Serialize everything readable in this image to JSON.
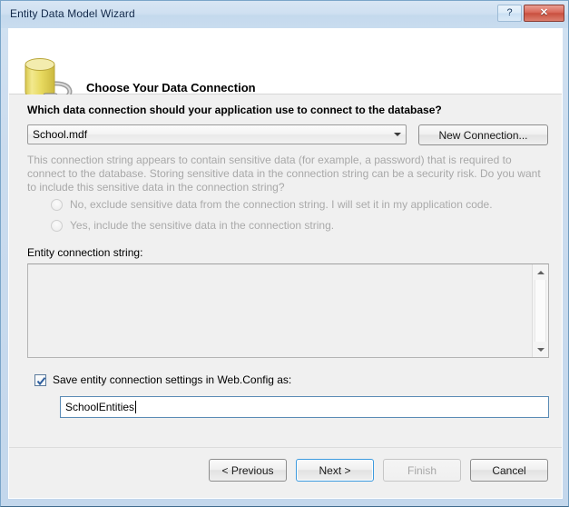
{
  "window": {
    "title": "Entity Data Model Wizard",
    "help_button": "?",
    "close_button": "✕"
  },
  "header": {
    "title": "Choose Your Data Connection",
    "icon": "database-plug-icon"
  },
  "main": {
    "question": "Which data connection should your application use to connect to the database?",
    "connection_combo": {
      "value": "School.mdf",
      "arrow_icon": "chevron-down-icon"
    },
    "new_connection_button": "New Connection...",
    "sensitive_warning": "This connection string appears to contain sensitive data (for example, a password) that is required to connect to the database. Storing sensitive data in the connection string can be a security risk. Do you want to include this sensitive data in the connection string?",
    "radios": [
      {
        "label": "No, exclude sensitive data from the connection string. I will set it in my application code.",
        "checked": false,
        "disabled": true
      },
      {
        "label": "Yes, include the sensitive data in the connection string.",
        "checked": false,
        "disabled": true
      }
    ],
    "entity_connection_string_label": "Entity connection string:",
    "entity_connection_string_value": "",
    "save_checkbox": {
      "label": "Save entity connection settings in Web.Config as:",
      "checked": true
    },
    "config_name_input": {
      "value": "SchoolEntities"
    }
  },
  "footer": {
    "buttons": [
      {
        "label": "< Previous",
        "state": "enabled"
      },
      {
        "label": "Next >",
        "state": "default"
      },
      {
        "label": "Finish",
        "state": "disabled"
      },
      {
        "label": "Cancel",
        "state": "enabled"
      }
    ]
  },
  "colors": {
    "title_bar": "#cfe0f1",
    "dialog_bg": "#f0f0f0",
    "header_bg": "#ffffff",
    "close_button": "#c9503f",
    "focus_border": "#3c9ade",
    "disabled_text": "#a8a8a8",
    "checkbox_check": "#2f5f9e",
    "db_icon": "#e8da6a"
  }
}
